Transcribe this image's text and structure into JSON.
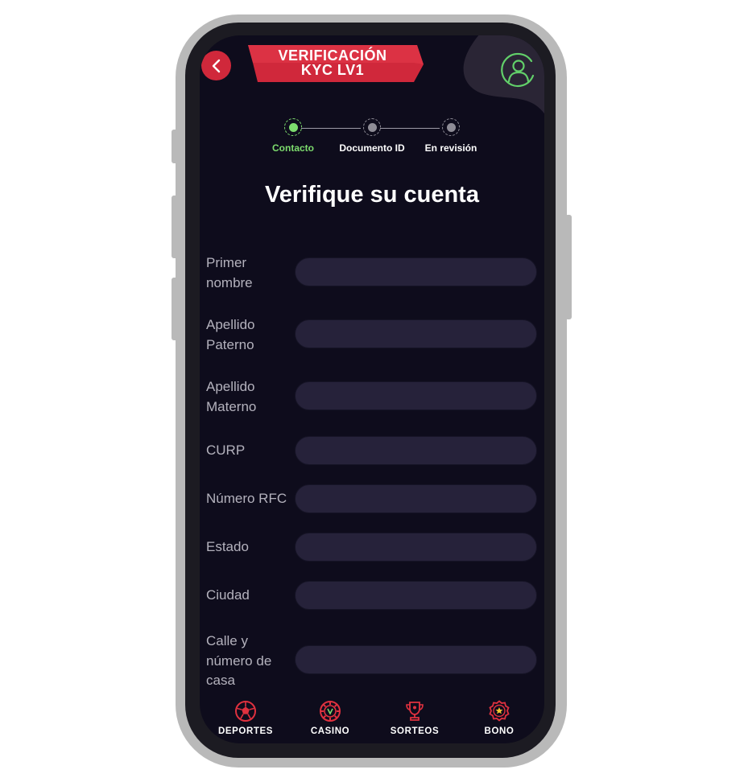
{
  "header": {
    "title_line1": "VERIFICACIÓN",
    "title_line2": "KYC LV1"
  },
  "stepper": {
    "steps": [
      {
        "label": "Contacto",
        "state": "active"
      },
      {
        "label": "Documento ID",
        "state": "pending"
      },
      {
        "label": "En revisión",
        "state": "pending"
      }
    ]
  },
  "page": {
    "title": "Verifique su cuenta"
  },
  "form": {
    "fields": [
      {
        "label": "Primer nombre",
        "value": "",
        "placeholder": ""
      },
      {
        "label": "Apellido Paterno",
        "value": "",
        "placeholder": ""
      },
      {
        "label": "Apellido Materno",
        "value": "",
        "placeholder": ""
      },
      {
        "label": "CURP",
        "value": "",
        "placeholder": ""
      },
      {
        "label": "Número RFC",
        "value": "",
        "placeholder": ""
      },
      {
        "label": "Estado",
        "value": "",
        "placeholder": ""
      },
      {
        "label": "Ciudad",
        "value": "",
        "placeholder": ""
      },
      {
        "label": "Calle y número de casa",
        "value": "",
        "placeholder": ""
      }
    ]
  },
  "bottom_nav": {
    "items": [
      {
        "label": "DEPORTES",
        "icon": "soccer-ball-icon"
      },
      {
        "label": "CASINO",
        "icon": "casino-chip-icon"
      },
      {
        "label": "SORTEOS",
        "icon": "trophy-icon"
      },
      {
        "label": "BONO",
        "icon": "bonus-badge-icon"
      }
    ]
  },
  "colors": {
    "background": "#0e0c1c",
    "accent_red": "#d0283b",
    "active_green": "#7ddc6e",
    "input_fill": "#26223a",
    "label_gray": "#b4b2bd"
  }
}
